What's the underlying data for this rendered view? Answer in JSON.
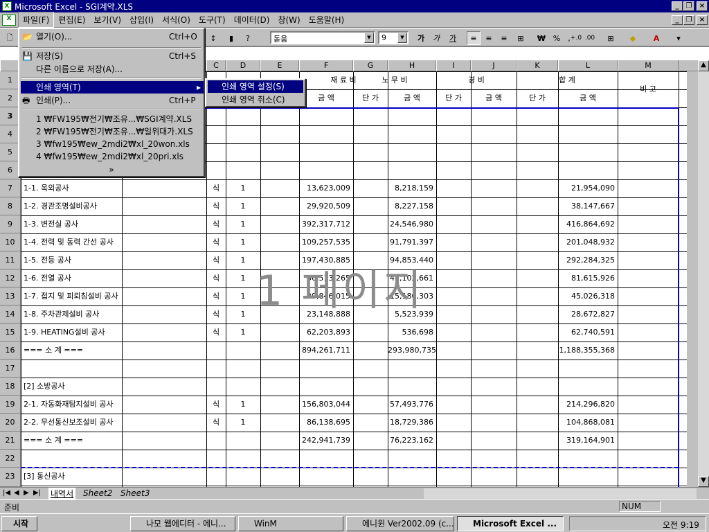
{
  "window": {
    "title": "Microsoft Excel - SGI계약.XLS"
  },
  "menubar": [
    "파일(F)",
    "편집(E)",
    "보기(V)",
    "삽입(I)",
    "서식(O)",
    "도구(T)",
    "데이터(D)",
    "창(W)",
    "도움말(H)"
  ],
  "toolbar": {
    "font": "돋움",
    "size": "9",
    "bold": "가",
    "italic": "가",
    "underline": "가",
    "currency": "₩",
    "percent": "%",
    "comma": ",",
    "inc": "+.0",
    "dec": ".00"
  },
  "filemenu": {
    "open": "열기(O)...",
    "open_sc": "Ctrl+O",
    "save": "저장(S)",
    "save_sc": "Ctrl+S",
    "saveas": "다른 이름으로 저장(A)...",
    "printarea": "인쇄 영역(T)",
    "print": "인쇄(P)...",
    "print_sc": "Ctrl+P",
    "recent": [
      "1 ₩FW195₩전기₩조유...₩SGI계약.XLS",
      "2 ₩FW195₩전기₩조유...₩일위대가.XLS",
      "3 ₩fw195₩ew_2mdi2₩xl_20won.xls",
      "4 ₩fw195₩ew_2mdi2₩xl_20pri.xls"
    ],
    "more": "»"
  },
  "submenu": {
    "set": "인쇄 영역 설정(S)",
    "clear": "인쇄 영역 취소(C)"
  },
  "columns": [
    "C",
    "D",
    "E",
    "F",
    "G",
    "H",
    "I",
    "J",
    "K",
    "L",
    "M"
  ],
  "header": {
    "material": "재 료 비",
    "labor": "노 무 비",
    "expense": "경 비",
    "total": "합 계",
    "note": "비 고",
    "amount": "금 액",
    "unit": "단 가"
  },
  "rows": [
    "1",
    "2",
    "3",
    "4",
    "5",
    "6",
    "7",
    "8",
    "9",
    "10",
    "11",
    "12",
    "13",
    "14",
    "15",
    "16",
    "17",
    "18",
    "19",
    "20",
    "21",
    "22",
    "23"
  ],
  "items": [
    {
      "name": "1-1. 옥외공사",
      "u": "식",
      "q": "1",
      "mat": "13,623,009",
      "lab": "8,218,159",
      "tot": "21,954,090"
    },
    {
      "name": "1-2. 경관조명설비공사",
      "u": "식",
      "q": "1",
      "mat": "29,920,509",
      "lab": "8,227,158",
      "tot": "38,147,667"
    },
    {
      "name": "1-3. 변전실 공사",
      "u": "식",
      "q": "1",
      "mat": "392,317,712",
      "lab": "24,546,980",
      "tot": "416,864,692"
    },
    {
      "name": "1-4. 전력 및 동력 간선 공사",
      "u": "식",
      "q": "1",
      "mat": "109,257,535",
      "lab": "91,791,397",
      "tot": "201,048,932"
    },
    {
      "name": "1-5. 전등 공사",
      "u": "식",
      "q": "1",
      "mat": "197,430,885",
      "lab": "94,853,440",
      "tot": "292,284,325"
    },
    {
      "name": "1-6. 전열 공사",
      "u": "식",
      "q": "1",
      "mat": "36,513,265",
      "lab": "45,102,661",
      "tot": "81,615,926"
    },
    {
      "name": "1-7. 접지 및 피뢰침설비 공사",
      "u": "식",
      "q": "1",
      "mat": "29,846,015",
      "lab": "15,180,303",
      "tot": "45,026,318"
    },
    {
      "name": "1-8. 주차관제설비 공사",
      "u": "식",
      "q": "1",
      "mat": "23,148,888",
      "lab": "5,523,939",
      "tot": "28,672,827"
    },
    {
      "name": "1-9. HEATING설비 공사",
      "u": "식",
      "q": "1",
      "mat": "62,203,893",
      "lab": "536,698",
      "tot": "62,740,591"
    },
    {
      "name": "=== 소 계 ===",
      "u": "",
      "q": "",
      "mat": "894,261,711",
      "lab": "293,980,735",
      "tot": "1,188,355,368"
    },
    {
      "name": "",
      "u": "",
      "q": "",
      "mat": "",
      "lab": "",
      "tot": ""
    },
    {
      "name": "[2] 소방공사",
      "u": "",
      "q": "",
      "mat": "",
      "lab": "",
      "tot": ""
    },
    {
      "name": "2-1. 자동화재탐지설비 공사",
      "u": "식",
      "q": "1",
      "mat": "156,803,044",
      "lab": "57,493,776",
      "tot": "214,296,820"
    },
    {
      "name": "2-2. 무선통신보조설비 공사",
      "u": "식",
      "q": "1",
      "mat": "86,138,695",
      "lab": "18,729,386",
      "tot": "104,868,081"
    },
    {
      "name": "=== 소 계 ===",
      "u": "",
      "q": "",
      "mat": "242,941,739",
      "lab": "76,223,162",
      "tot": "319,164,901"
    },
    {
      "name": "",
      "u": "",
      "q": "",
      "mat": "",
      "lab": "",
      "tot": ""
    },
    {
      "name": "[3] 통신공사",
      "u": "",
      "q": "",
      "mat": "",
      "lab": "",
      "tot": ""
    }
  ],
  "watermark": "1 페이지",
  "sheets": [
    "내역서",
    "Sheet2",
    "Sheet3"
  ],
  "status": {
    "ready": "준비",
    "num": "NUM"
  },
  "taskbar": {
    "start": "시작",
    "tasks": [
      "나모 웹에디터 - 에니...",
      "WinM",
      "에니윈 Ver2002.09 (c...",
      "Microsoft Excel ..."
    ],
    "clock": "오전 9:19"
  }
}
